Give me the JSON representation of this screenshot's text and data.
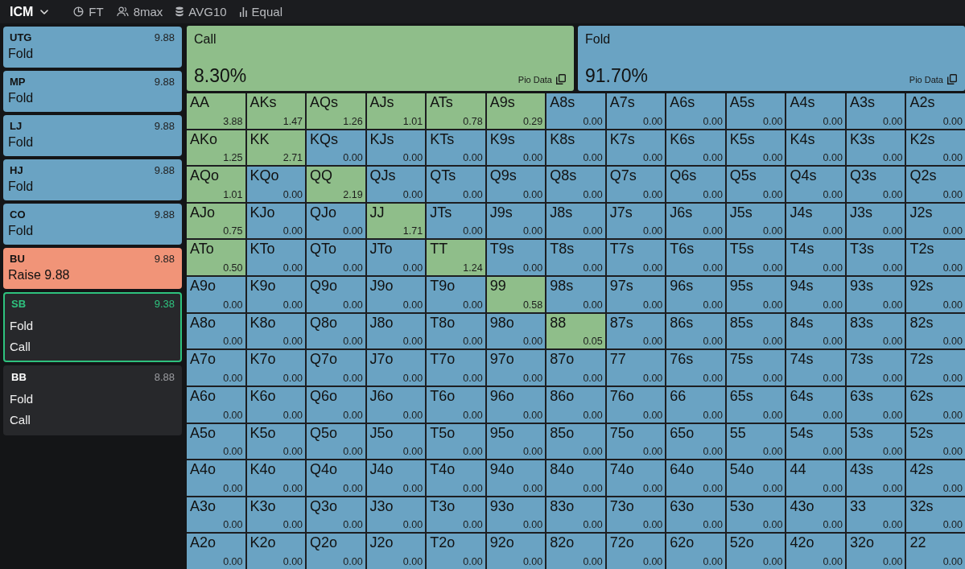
{
  "topbar": {
    "mode": "ICM",
    "filters": [
      {
        "label": "FT"
      },
      {
        "label": "8max"
      },
      {
        "label": "AVG10"
      },
      {
        "label": "Equal"
      }
    ]
  },
  "seats": [
    {
      "kind": "acted",
      "position": "UTG",
      "stack": "9.88",
      "selected": false,
      "action": {
        "kind": "fold",
        "label": "Fold"
      }
    },
    {
      "kind": "acted",
      "position": "MP",
      "stack": "9.88",
      "selected": false,
      "action": {
        "kind": "fold",
        "label": "Fold"
      }
    },
    {
      "kind": "acted",
      "position": "LJ",
      "stack": "9.88",
      "selected": false,
      "action": {
        "kind": "fold",
        "label": "Fold"
      }
    },
    {
      "kind": "acted",
      "position": "HJ",
      "stack": "9.88",
      "selected": false,
      "action": {
        "kind": "fold",
        "label": "Fold"
      }
    },
    {
      "kind": "acted",
      "position": "CO",
      "stack": "9.88",
      "selected": false,
      "action": {
        "kind": "fold",
        "label": "Fold"
      }
    },
    {
      "kind": "acted",
      "position": "BU",
      "stack": "9.88",
      "selected": false,
      "action": {
        "kind": "raise",
        "label": "Raise 9.88"
      }
    },
    {
      "kind": "pending",
      "position": "SB",
      "stack": "9.38",
      "selected": true,
      "options": [
        "Fold",
        "Call"
      ]
    },
    {
      "kind": "pending",
      "position": "BB",
      "stack": "8.88",
      "selected": false,
      "options": [
        "Fold",
        "Call"
      ]
    }
  ],
  "actions": [
    {
      "kind": "call",
      "label": "Call",
      "frequency": "8.30%",
      "source": "Pio Data"
    },
    {
      "kind": "fold",
      "label": "Fold",
      "frequency": "91.70%",
      "source": "Pio Data"
    }
  ],
  "range_grid": {
    "rows": [
      [
        {
          "hand": "AA",
          "value": "3.88",
          "kind": "call"
        },
        {
          "hand": "AKs",
          "value": "1.47",
          "kind": "call"
        },
        {
          "hand": "AQs",
          "value": "1.26",
          "kind": "call"
        },
        {
          "hand": "AJs",
          "value": "1.01",
          "kind": "call"
        },
        {
          "hand": "ATs",
          "value": "0.78",
          "kind": "call"
        },
        {
          "hand": "A9s",
          "value": "0.29",
          "kind": "call"
        },
        {
          "hand": "A8s",
          "value": "0.00",
          "kind": "fold"
        },
        {
          "hand": "A7s",
          "value": "0.00",
          "kind": "fold"
        },
        {
          "hand": "A6s",
          "value": "0.00",
          "kind": "fold"
        },
        {
          "hand": "A5s",
          "value": "0.00",
          "kind": "fold"
        },
        {
          "hand": "A4s",
          "value": "0.00",
          "kind": "fold"
        },
        {
          "hand": "A3s",
          "value": "0.00",
          "kind": "fold"
        },
        {
          "hand": "A2s",
          "value": "0.00",
          "kind": "fold"
        }
      ],
      [
        {
          "hand": "AKo",
          "value": "1.25",
          "kind": "call"
        },
        {
          "hand": "KK",
          "value": "2.71",
          "kind": "call"
        },
        {
          "hand": "KQs",
          "value": "0.00",
          "kind": "fold"
        },
        {
          "hand": "KJs",
          "value": "0.00",
          "kind": "fold"
        },
        {
          "hand": "KTs",
          "value": "0.00",
          "kind": "fold"
        },
        {
          "hand": "K9s",
          "value": "0.00",
          "kind": "fold"
        },
        {
          "hand": "K8s",
          "value": "0.00",
          "kind": "fold"
        },
        {
          "hand": "K7s",
          "value": "0.00",
          "kind": "fold"
        },
        {
          "hand": "K6s",
          "value": "0.00",
          "kind": "fold"
        },
        {
          "hand": "K5s",
          "value": "0.00",
          "kind": "fold"
        },
        {
          "hand": "K4s",
          "value": "0.00",
          "kind": "fold"
        },
        {
          "hand": "K3s",
          "value": "0.00",
          "kind": "fold"
        },
        {
          "hand": "K2s",
          "value": "0.00",
          "kind": "fold"
        }
      ],
      [
        {
          "hand": "AQo",
          "value": "1.01",
          "kind": "call"
        },
        {
          "hand": "KQo",
          "value": "0.00",
          "kind": "fold"
        },
        {
          "hand": "QQ",
          "value": "2.19",
          "kind": "call"
        },
        {
          "hand": "QJs",
          "value": "0.00",
          "kind": "fold"
        },
        {
          "hand": "QTs",
          "value": "0.00",
          "kind": "fold"
        },
        {
          "hand": "Q9s",
          "value": "0.00",
          "kind": "fold"
        },
        {
          "hand": "Q8s",
          "value": "0.00",
          "kind": "fold"
        },
        {
          "hand": "Q7s",
          "value": "0.00",
          "kind": "fold"
        },
        {
          "hand": "Q6s",
          "value": "0.00",
          "kind": "fold"
        },
        {
          "hand": "Q5s",
          "value": "0.00",
          "kind": "fold"
        },
        {
          "hand": "Q4s",
          "value": "0.00",
          "kind": "fold"
        },
        {
          "hand": "Q3s",
          "value": "0.00",
          "kind": "fold"
        },
        {
          "hand": "Q2s",
          "value": "0.00",
          "kind": "fold"
        }
      ],
      [
        {
          "hand": "AJo",
          "value": "0.75",
          "kind": "call"
        },
        {
          "hand": "KJo",
          "value": "0.00",
          "kind": "fold"
        },
        {
          "hand": "QJo",
          "value": "0.00",
          "kind": "fold"
        },
        {
          "hand": "JJ",
          "value": "1.71",
          "kind": "call"
        },
        {
          "hand": "JTs",
          "value": "0.00",
          "kind": "fold"
        },
        {
          "hand": "J9s",
          "value": "0.00",
          "kind": "fold"
        },
        {
          "hand": "J8s",
          "value": "0.00",
          "kind": "fold"
        },
        {
          "hand": "J7s",
          "value": "0.00",
          "kind": "fold"
        },
        {
          "hand": "J6s",
          "value": "0.00",
          "kind": "fold"
        },
        {
          "hand": "J5s",
          "value": "0.00",
          "kind": "fold"
        },
        {
          "hand": "J4s",
          "value": "0.00",
          "kind": "fold"
        },
        {
          "hand": "J3s",
          "value": "0.00",
          "kind": "fold"
        },
        {
          "hand": "J2s",
          "value": "0.00",
          "kind": "fold"
        }
      ],
      [
        {
          "hand": "ATo",
          "value": "0.50",
          "kind": "call"
        },
        {
          "hand": "KTo",
          "value": "0.00",
          "kind": "fold"
        },
        {
          "hand": "QTo",
          "value": "0.00",
          "kind": "fold"
        },
        {
          "hand": "JTo",
          "value": "0.00",
          "kind": "fold"
        },
        {
          "hand": "TT",
          "value": "1.24",
          "kind": "call"
        },
        {
          "hand": "T9s",
          "value": "0.00",
          "kind": "fold"
        },
        {
          "hand": "T8s",
          "value": "0.00",
          "kind": "fold"
        },
        {
          "hand": "T7s",
          "value": "0.00",
          "kind": "fold"
        },
        {
          "hand": "T6s",
          "value": "0.00",
          "kind": "fold"
        },
        {
          "hand": "T5s",
          "value": "0.00",
          "kind": "fold"
        },
        {
          "hand": "T4s",
          "value": "0.00",
          "kind": "fold"
        },
        {
          "hand": "T3s",
          "value": "0.00",
          "kind": "fold"
        },
        {
          "hand": "T2s",
          "value": "0.00",
          "kind": "fold"
        }
      ],
      [
        {
          "hand": "A9o",
          "value": "0.00",
          "kind": "fold"
        },
        {
          "hand": "K9o",
          "value": "0.00",
          "kind": "fold"
        },
        {
          "hand": "Q9o",
          "value": "0.00",
          "kind": "fold"
        },
        {
          "hand": "J9o",
          "value": "0.00",
          "kind": "fold"
        },
        {
          "hand": "T9o",
          "value": "0.00",
          "kind": "fold"
        },
        {
          "hand": "99",
          "value": "0.58",
          "kind": "call"
        },
        {
          "hand": "98s",
          "value": "0.00",
          "kind": "fold"
        },
        {
          "hand": "97s",
          "value": "0.00",
          "kind": "fold"
        },
        {
          "hand": "96s",
          "value": "0.00",
          "kind": "fold"
        },
        {
          "hand": "95s",
          "value": "0.00",
          "kind": "fold"
        },
        {
          "hand": "94s",
          "value": "0.00",
          "kind": "fold"
        },
        {
          "hand": "93s",
          "value": "0.00",
          "kind": "fold"
        },
        {
          "hand": "92s",
          "value": "0.00",
          "kind": "fold"
        }
      ],
      [
        {
          "hand": "A8o",
          "value": "0.00",
          "kind": "fold"
        },
        {
          "hand": "K8o",
          "value": "0.00",
          "kind": "fold"
        },
        {
          "hand": "Q8o",
          "value": "0.00",
          "kind": "fold"
        },
        {
          "hand": "J8o",
          "value": "0.00",
          "kind": "fold"
        },
        {
          "hand": "T8o",
          "value": "0.00",
          "kind": "fold"
        },
        {
          "hand": "98o",
          "value": "0.00",
          "kind": "fold"
        },
        {
          "hand": "88",
          "value": "0.05",
          "kind": "call"
        },
        {
          "hand": "87s",
          "value": "0.00",
          "kind": "fold"
        },
        {
          "hand": "86s",
          "value": "0.00",
          "kind": "fold"
        },
        {
          "hand": "85s",
          "value": "0.00",
          "kind": "fold"
        },
        {
          "hand": "84s",
          "value": "0.00",
          "kind": "fold"
        },
        {
          "hand": "83s",
          "value": "0.00",
          "kind": "fold"
        },
        {
          "hand": "82s",
          "value": "0.00",
          "kind": "fold"
        }
      ],
      [
        {
          "hand": "A7o",
          "value": "0.00",
          "kind": "fold"
        },
        {
          "hand": "K7o",
          "value": "0.00",
          "kind": "fold"
        },
        {
          "hand": "Q7o",
          "value": "0.00",
          "kind": "fold"
        },
        {
          "hand": "J7o",
          "value": "0.00",
          "kind": "fold"
        },
        {
          "hand": "T7o",
          "value": "0.00",
          "kind": "fold"
        },
        {
          "hand": "97o",
          "value": "0.00",
          "kind": "fold"
        },
        {
          "hand": "87o",
          "value": "0.00",
          "kind": "fold"
        },
        {
          "hand": "77",
          "value": "0.00",
          "kind": "fold"
        },
        {
          "hand": "76s",
          "value": "0.00",
          "kind": "fold"
        },
        {
          "hand": "75s",
          "value": "0.00",
          "kind": "fold"
        },
        {
          "hand": "74s",
          "value": "0.00",
          "kind": "fold"
        },
        {
          "hand": "73s",
          "value": "0.00",
          "kind": "fold"
        },
        {
          "hand": "72s",
          "value": "0.00",
          "kind": "fold"
        }
      ],
      [
        {
          "hand": "A6o",
          "value": "0.00",
          "kind": "fold"
        },
        {
          "hand": "K6o",
          "value": "0.00",
          "kind": "fold"
        },
        {
          "hand": "Q6o",
          "value": "0.00",
          "kind": "fold"
        },
        {
          "hand": "J6o",
          "value": "0.00",
          "kind": "fold"
        },
        {
          "hand": "T6o",
          "value": "0.00",
          "kind": "fold"
        },
        {
          "hand": "96o",
          "value": "0.00",
          "kind": "fold"
        },
        {
          "hand": "86o",
          "value": "0.00",
          "kind": "fold"
        },
        {
          "hand": "76o",
          "value": "0.00",
          "kind": "fold"
        },
        {
          "hand": "66",
          "value": "0.00",
          "kind": "fold"
        },
        {
          "hand": "65s",
          "value": "0.00",
          "kind": "fold"
        },
        {
          "hand": "64s",
          "value": "0.00",
          "kind": "fold"
        },
        {
          "hand": "63s",
          "value": "0.00",
          "kind": "fold"
        },
        {
          "hand": "62s",
          "value": "0.00",
          "kind": "fold"
        }
      ],
      [
        {
          "hand": "A5o",
          "value": "0.00",
          "kind": "fold"
        },
        {
          "hand": "K5o",
          "value": "0.00",
          "kind": "fold"
        },
        {
          "hand": "Q5o",
          "value": "0.00",
          "kind": "fold"
        },
        {
          "hand": "J5o",
          "value": "0.00",
          "kind": "fold"
        },
        {
          "hand": "T5o",
          "value": "0.00",
          "kind": "fold"
        },
        {
          "hand": "95o",
          "value": "0.00",
          "kind": "fold"
        },
        {
          "hand": "85o",
          "value": "0.00",
          "kind": "fold"
        },
        {
          "hand": "75o",
          "value": "0.00",
          "kind": "fold"
        },
        {
          "hand": "65o",
          "value": "0.00",
          "kind": "fold"
        },
        {
          "hand": "55",
          "value": "0.00",
          "kind": "fold"
        },
        {
          "hand": "54s",
          "value": "0.00",
          "kind": "fold"
        },
        {
          "hand": "53s",
          "value": "0.00",
          "kind": "fold"
        },
        {
          "hand": "52s",
          "value": "0.00",
          "kind": "fold"
        }
      ],
      [
        {
          "hand": "A4o",
          "value": "0.00",
          "kind": "fold"
        },
        {
          "hand": "K4o",
          "value": "0.00",
          "kind": "fold"
        },
        {
          "hand": "Q4o",
          "value": "0.00",
          "kind": "fold"
        },
        {
          "hand": "J4o",
          "value": "0.00",
          "kind": "fold"
        },
        {
          "hand": "T4o",
          "value": "0.00",
          "kind": "fold"
        },
        {
          "hand": "94o",
          "value": "0.00",
          "kind": "fold"
        },
        {
          "hand": "84o",
          "value": "0.00",
          "kind": "fold"
        },
        {
          "hand": "74o",
          "value": "0.00",
          "kind": "fold"
        },
        {
          "hand": "64o",
          "value": "0.00",
          "kind": "fold"
        },
        {
          "hand": "54o",
          "value": "0.00",
          "kind": "fold"
        },
        {
          "hand": "44",
          "value": "0.00",
          "kind": "fold"
        },
        {
          "hand": "43s",
          "value": "0.00",
          "kind": "fold"
        },
        {
          "hand": "42s",
          "value": "0.00",
          "kind": "fold"
        }
      ],
      [
        {
          "hand": "A3o",
          "value": "0.00",
          "kind": "fold"
        },
        {
          "hand": "K3o",
          "value": "0.00",
          "kind": "fold"
        },
        {
          "hand": "Q3o",
          "value": "0.00",
          "kind": "fold"
        },
        {
          "hand": "J3o",
          "value": "0.00",
          "kind": "fold"
        },
        {
          "hand": "T3o",
          "value": "0.00",
          "kind": "fold"
        },
        {
          "hand": "93o",
          "value": "0.00",
          "kind": "fold"
        },
        {
          "hand": "83o",
          "value": "0.00",
          "kind": "fold"
        },
        {
          "hand": "73o",
          "value": "0.00",
          "kind": "fold"
        },
        {
          "hand": "63o",
          "value": "0.00",
          "kind": "fold"
        },
        {
          "hand": "53o",
          "value": "0.00",
          "kind": "fold"
        },
        {
          "hand": "43o",
          "value": "0.00",
          "kind": "fold"
        },
        {
          "hand": "33",
          "value": "0.00",
          "kind": "fold"
        },
        {
          "hand": "32s",
          "value": "0.00",
          "kind": "fold"
        }
      ],
      [
        {
          "hand": "A2o",
          "value": "0.00",
          "kind": "fold"
        },
        {
          "hand": "K2o",
          "value": "0.00",
          "kind": "fold"
        },
        {
          "hand": "Q2o",
          "value": "0.00",
          "kind": "fold"
        },
        {
          "hand": "J2o",
          "value": "0.00",
          "kind": "fold"
        },
        {
          "hand": "T2o",
          "value": "0.00",
          "kind": "fold"
        },
        {
          "hand": "92o",
          "value": "0.00",
          "kind": "fold"
        },
        {
          "hand": "82o",
          "value": "0.00",
          "kind": "fold"
        },
        {
          "hand": "72o",
          "value": "0.00",
          "kind": "fold"
        },
        {
          "hand": "62o",
          "value": "0.00",
          "kind": "fold"
        },
        {
          "hand": "52o",
          "value": "0.00",
          "kind": "fold"
        },
        {
          "hand": "42o",
          "value": "0.00",
          "kind": "fold"
        },
        {
          "hand": "32o",
          "value": "0.00",
          "kind": "fold"
        },
        {
          "hand": "22",
          "value": "0.00",
          "kind": "fold"
        }
      ]
    ]
  }
}
